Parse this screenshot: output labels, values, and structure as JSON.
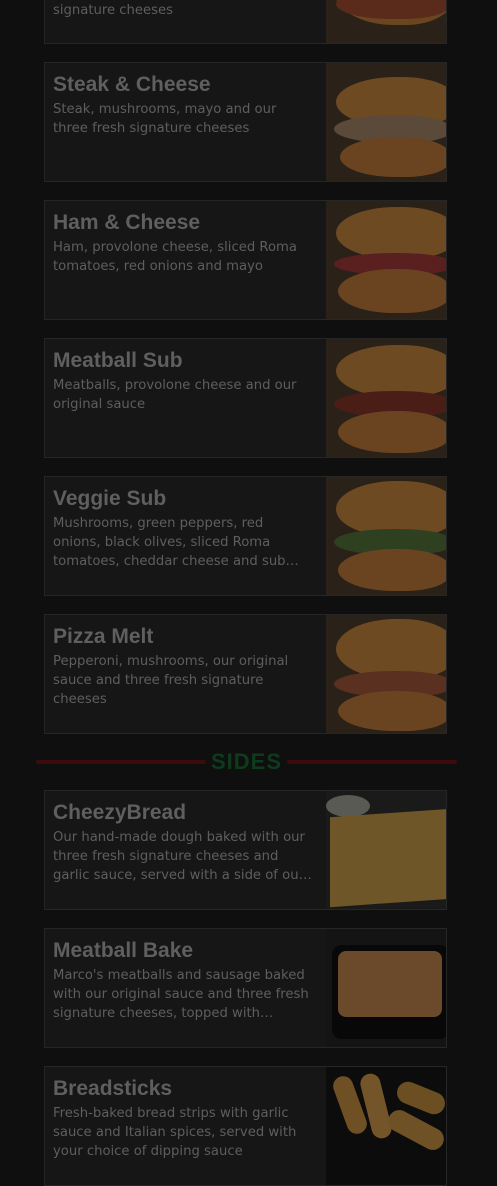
{
  "partial_top_item": {
    "description_tail": "signature cheeses"
  },
  "subs": [
    {
      "title": "Steak & Cheese",
      "description": "Steak, mushrooms, mayo and our three fresh signature cheeses",
      "image_icon": "steak-sub-image"
    },
    {
      "title": "Ham & Cheese",
      "description": "Ham, provolone cheese, sliced Roma tomatoes, red onions and mayo",
      "image_icon": "ham-sub-image"
    },
    {
      "title": "Meatball Sub",
      "description": "Meatballs, provolone cheese and our original sauce",
      "image_icon": "meatball-sub-image"
    },
    {
      "title": "Veggie Sub",
      "description": "Mushrooms, green peppers, red onions, black olives, sliced Roma tomatoes, cheddar cheese and sub dressing",
      "image_icon": "veggie-sub-image"
    },
    {
      "title": "Pizza Melt",
      "description": "Pepperoni, mushrooms, our original sauce and three fresh signature cheeses",
      "image_icon": "pizza-melt-image"
    }
  ],
  "sides_header": "SIDES",
  "sides": [
    {
      "title": "CheezyBread",
      "description": "Our hand-made dough baked with our three fresh signature cheeses and garlic sauce, served with a side of our original…",
      "image_icon": "cheezybread-image"
    },
    {
      "title": "Meatball Bake",
      "description": "Marco's meatballs and sausage baked with our original sauce and three fresh signature cheeses, topped with…",
      "image_icon": "meatball-bake-image"
    },
    {
      "title": "Breadsticks",
      "description": "Fresh-baked bread strips with garlic sauce and Italian spices, served with your choice of dipping sauce",
      "image_icon": "breadsticks-image"
    }
  ],
  "colors": {
    "background": "#0f0f0f",
    "card": "#161616",
    "title": "#5f5f5f",
    "sides_label": "#0e3b1b",
    "sides_rule": "#3d0b0d"
  }
}
